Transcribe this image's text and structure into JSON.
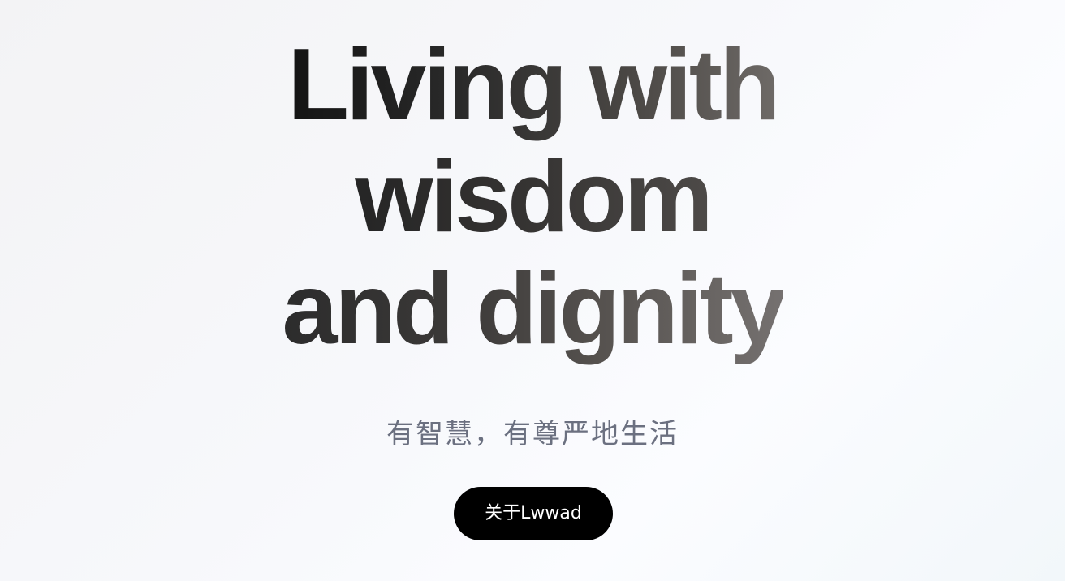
{
  "hero": {
    "headline": {
      "line1": "Living with",
      "line2": "wisdom",
      "line3": "and dignity"
    },
    "subtitle": "有智慧，有尊严地生活",
    "about_button_label": "关于Lwwad"
  },
  "colors": {
    "headline_dark": "#141414",
    "headline_light": "#757170",
    "subtitle": "#6b7080",
    "button_bg": "#000000",
    "button_text": "#ffffff"
  }
}
